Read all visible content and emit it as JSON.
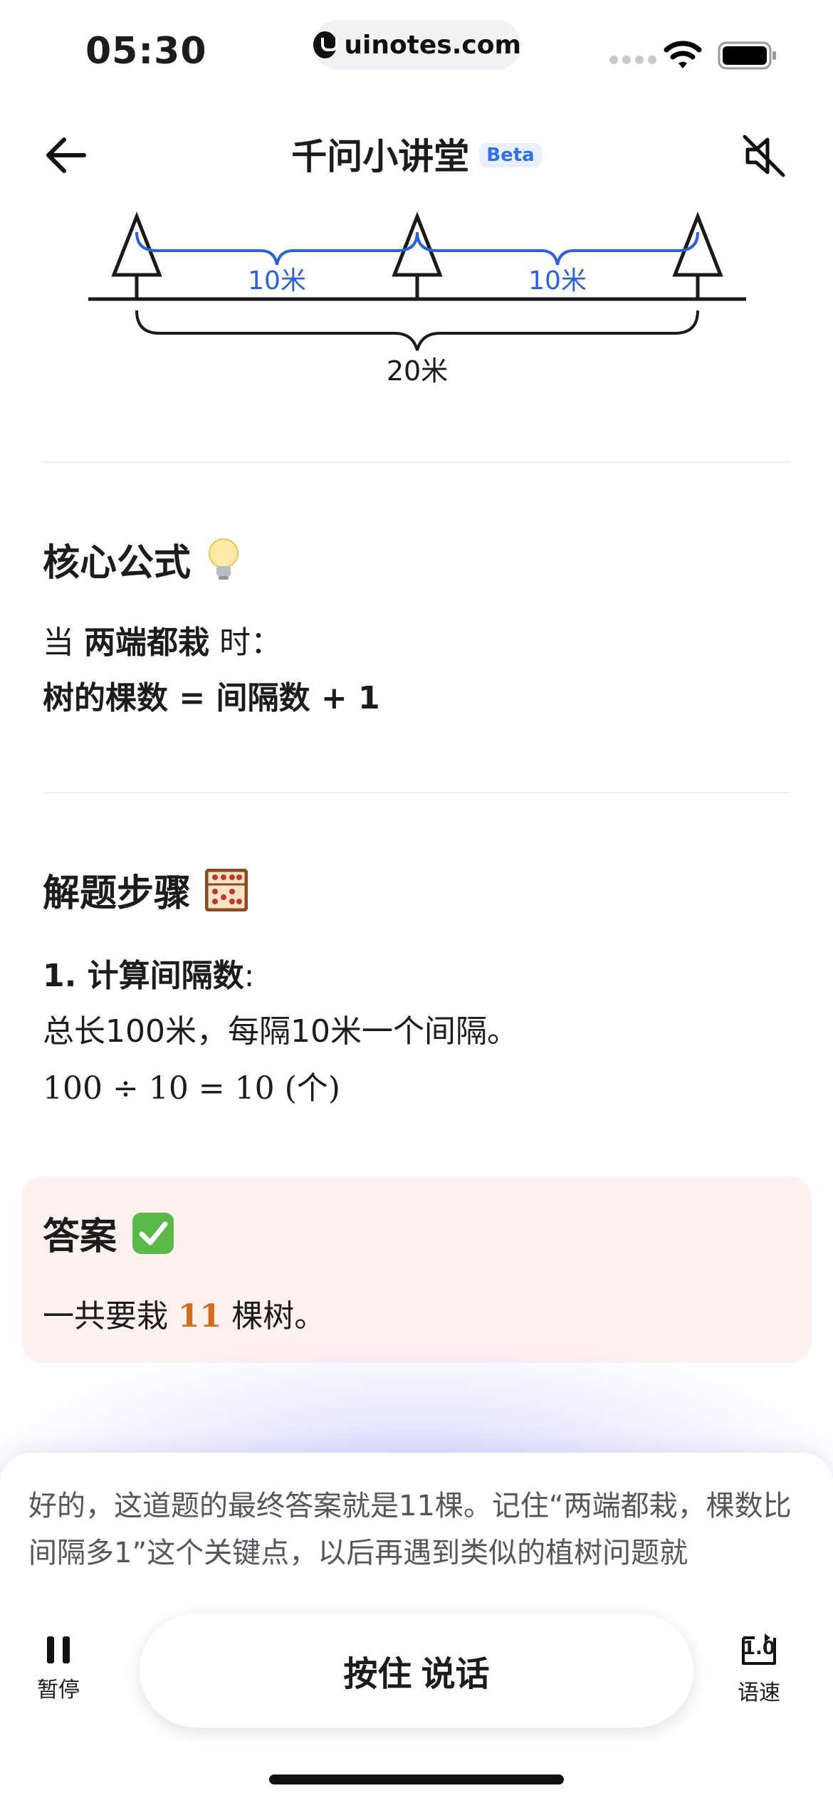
{
  "status_bar": {
    "time": "05:30",
    "url": "uinotes.com"
  },
  "header": {
    "title": "千问小讲堂",
    "badge": "Beta"
  },
  "diagram": {
    "label_left": "10米",
    "label_right": "10米",
    "label_total": "20米"
  },
  "formula": {
    "heading": "核心公式",
    "line1_prefix": "当 ",
    "line1_bold": "两端都栽",
    "line1_suffix": " 时：",
    "line2_bold": "树的棵数",
    "line2_rest": " = 间隔数 + 1"
  },
  "steps": {
    "heading": "解题步骤",
    "step1_title": "1. 计算间隔数",
    "step1_colon": ":",
    "step1_text": "总长100米，每隔10米一个间隔。",
    "step1_calc": "100 ÷ 10 = 10 (个)"
  },
  "answer": {
    "heading": "答案",
    "prefix": "一共要栽 ",
    "number": "11",
    "suffix": " 棵树。"
  },
  "caption": "好的，这道题的最终答案就是11棵。记住“两端都栽，棵数比间隔多1”这个关键点，以后再遇到类似的植树问题就",
  "controls": {
    "pause_label": "暂停",
    "talk_label": "按住 说话",
    "speed_value": "1.0",
    "speed_label": "语速"
  }
}
